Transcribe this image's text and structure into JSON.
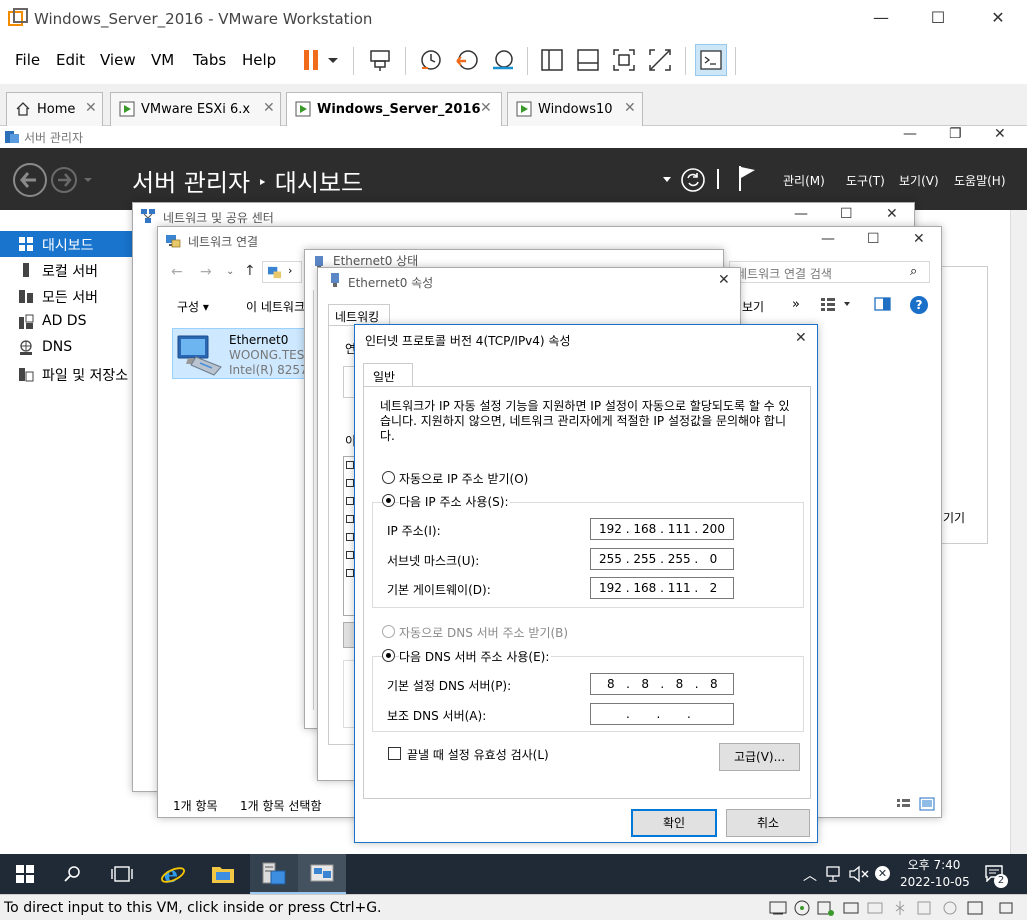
{
  "vmware": {
    "title": "Windows_Server_2016 - VMware Workstation",
    "menu": [
      "File",
      "Edit",
      "View",
      "VM",
      "Tabs",
      "Help"
    ],
    "tabs": [
      {
        "label": "Home",
        "active": false
      },
      {
        "label": "VMware ESXi 6.x",
        "active": false
      },
      {
        "label": "Windows_Server_2016",
        "active": true
      },
      {
        "label": "Windows10",
        "active": false
      }
    ],
    "status_text": "To direct input to this VM, click inside or press Ctrl+G."
  },
  "server_manager": {
    "window_title": "서버 관리자",
    "breadcrumb_root": "서버 관리자",
    "breadcrumb_sep": "‣",
    "breadcrumb_page": "대시보드",
    "header_menu": [
      "관리(M)",
      "도구(T)",
      "보기(V)",
      "도움말(H)"
    ],
    "nav": [
      {
        "label": "대시보드",
        "active": true
      },
      {
        "label": "로컬 서버",
        "active": false
      },
      {
        "label": "모든 서버",
        "active": false
      },
      {
        "label": "AD DS",
        "active": false
      },
      {
        "label": "DNS",
        "active": false
      },
      {
        "label": "파일 및 저장소",
        "active": false
      }
    ],
    "partial_right_text": "기기"
  },
  "network_center": {
    "title": "네트워크 및 공유 센터"
  },
  "network_connections": {
    "title": "네트워크 연결",
    "search_placeholder": "네트워크 연결 검색",
    "toolbar_organize": "구성 ▾",
    "toolbar_this": "이 네트워크",
    "toolbar_view": "보기",
    "toolbar_more": "»",
    "adapter": {
      "name": "Ethernet0",
      "domain": "WOONG.TEST",
      "device": "Intel(R) 82574"
    },
    "status_items": "1개 항목",
    "status_selected": "1개 항목 선택함"
  },
  "ethernet_status": {
    "title": "Ethernet0 상태"
  },
  "ethernet_props": {
    "title": "Ethernet0 속성",
    "tab": "네트워킹",
    "partial_text_1": "연",
    "partial_text_2": "이"
  },
  "ipv4": {
    "title": "인터넷 프로토콜 버전 4(TCP/IPv4) 속성",
    "tab": "일반",
    "description": "네트워크가 IP 자동 설정 기능을 지원하면 IP 설정이 자동으로 할당되도록 할 수 있습니다. 지원하지 않으면, 네트워크 관리자에게 적절한 IP 설정값을 문의해야 합니다.",
    "auto_ip_label": "자동으로 IP 주소 받기(O)",
    "manual_ip_label": "다음 IP 주소 사용(S):",
    "ip_label": "IP 주소(I):",
    "subnet_label": "서브넷 마스크(U):",
    "gateway_label": "기본 게이트웨이(D):",
    "ip_value": "192 . 168 . 111 . 200",
    "subnet_value": "255 . 255 . 255 .   0",
    "gateway_value": "192 . 168 . 111 .   2",
    "auto_dns_label": "자동으로 DNS 서버 주소 받기(B)",
    "manual_dns_label": "다음 DNS 서버 주소 사용(E):",
    "pref_dns_label": "기본 설정 DNS 서버(P):",
    "alt_dns_label": "보조 DNS 서버(A):",
    "pref_dns_value": "8   .   8   .   8   .   8",
    "alt_dns_value": ".       .       .",
    "validate_label": "끝낼 때 설정 유효성 검사(L)",
    "advanced_button": "고급(V)...",
    "ok_button": "확인",
    "cancel_button": "취소"
  },
  "taskbar": {
    "time": "오후 7:40",
    "date": "2022-10-05",
    "notification_count": "2"
  }
}
